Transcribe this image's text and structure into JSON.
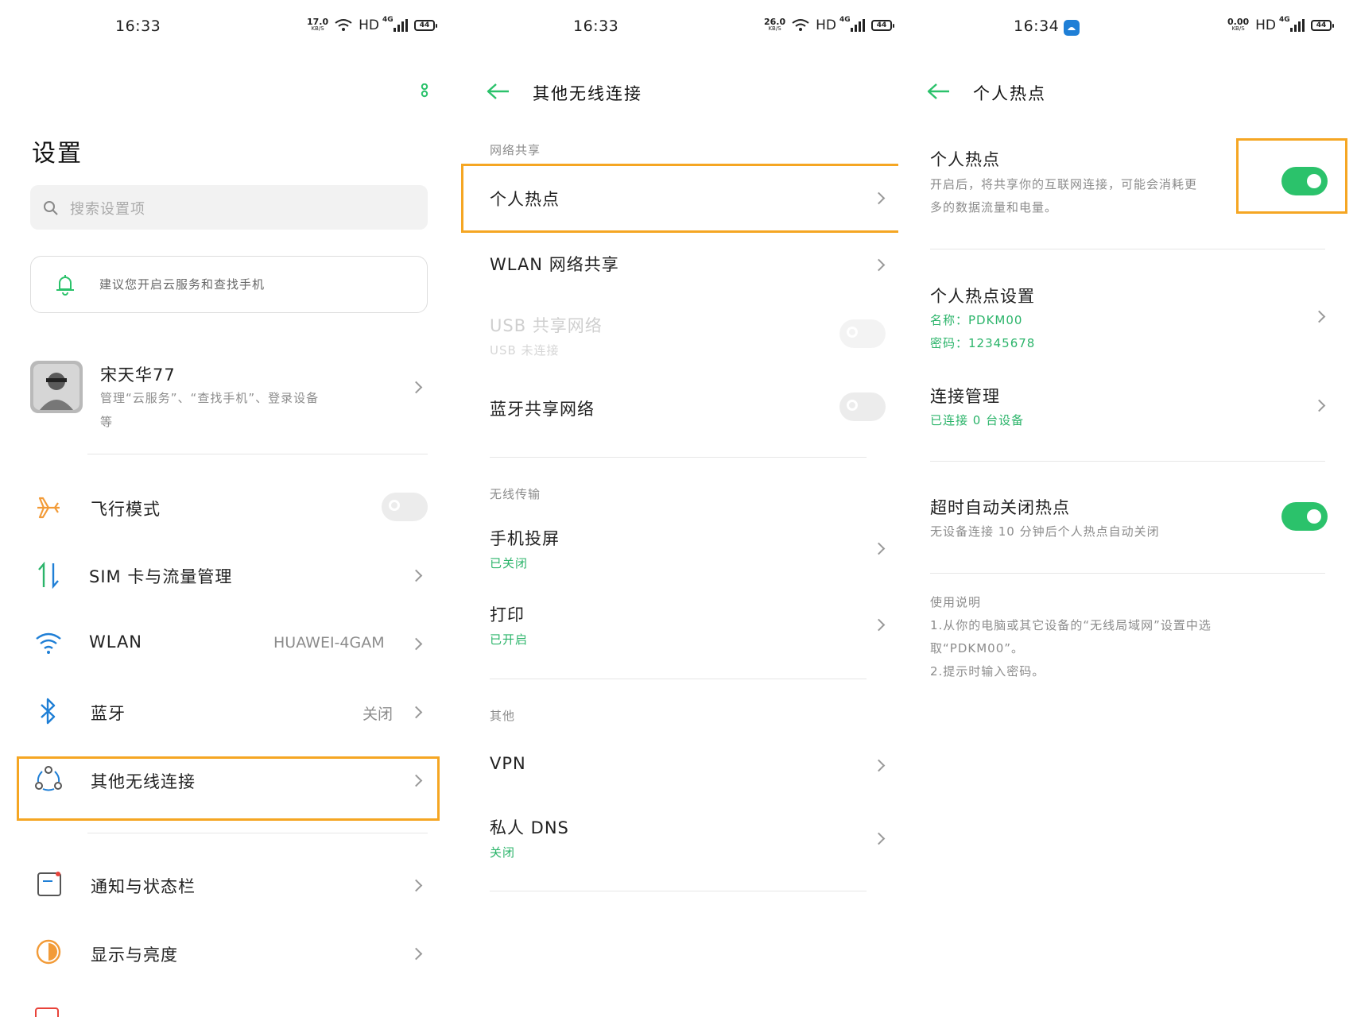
{
  "accent_color": "#2bc26b",
  "highlight_color": "#f5a623",
  "screen1": {
    "status": {
      "time": "16:33",
      "speed": "17.0",
      "speed_unit": "KB/S",
      "hd": "HD",
      "net": "4G",
      "battery": "44"
    },
    "title": "设置",
    "search": {
      "placeholder": "搜索设置项"
    },
    "notice": "建议您开启云服务和查找手机",
    "account": {
      "name": "宋天华77",
      "desc_line1": "管理“云服务”、“查找手机”、登录设备",
      "desc_line2": "等"
    },
    "items": [
      {
        "label": "飞行模式",
        "icon": "airplane-icon",
        "toggle": "off"
      },
      {
        "label": "SIM 卡与流量管理",
        "icon": "sim-data-icon"
      },
      {
        "label": "WLAN",
        "icon": "wifi-icon",
        "value": "HUAWEI-4GAM"
      },
      {
        "label": "蓝牙",
        "icon": "bluetooth-icon",
        "value": "关闭"
      },
      {
        "label": "其他无线连接",
        "icon": "connections-icon",
        "highlighted": true
      },
      {
        "label": "通知与状态栏",
        "icon": "notification-icon"
      },
      {
        "label": "显示与亮度",
        "icon": "display-icon"
      }
    ]
  },
  "screen2": {
    "status": {
      "time": "16:33",
      "speed": "26.0",
      "speed_unit": "KB/S",
      "hd": "HD",
      "net": "4G",
      "battery": "44"
    },
    "title": "其他无线连接",
    "sections": [
      {
        "label": "网络共享"
      },
      {
        "label": "无线传输"
      },
      {
        "label": "其他"
      }
    ],
    "items": [
      {
        "label": "个人热点",
        "highlighted": true
      },
      {
        "label": "WLAN 网络共享"
      },
      {
        "label": "USB 共享网络",
        "sub": "USB 未连接",
        "toggle": "off",
        "disabled": true
      },
      {
        "label": "蓝牙共享网络",
        "toggle": "off"
      },
      {
        "label": "手机投屏",
        "sub": "已关闭"
      },
      {
        "label": "打印",
        "sub": "已开启"
      },
      {
        "label": "VPN"
      },
      {
        "label": "私人 DNS",
        "sub": "关闭"
      }
    ]
  },
  "screen3": {
    "status": {
      "time": "16:34",
      "speed": "0.00",
      "speed_unit": "KB/S",
      "hd": "HD",
      "net": "4G",
      "battery": "44"
    },
    "title": "个人热点",
    "hotspot": {
      "label": "个人热点",
      "desc_line1": "开启后，将共享你的互联网连接，可能会消耗更",
      "desc_line2": "多的数据流量和电量。",
      "toggle": "on"
    },
    "settings": {
      "label": "个人热点设置",
      "name_line": "名称：PDKM00",
      "password_line": "密码：12345678"
    },
    "connections": {
      "label": "连接管理",
      "sub": "已连接 0 台设备"
    },
    "auto_off": {
      "label": "超时自动关闭热点",
      "sub": "无设备连接 10 分钟后个人热点自动关闭",
      "toggle": "on"
    },
    "usage": {
      "title": "使用说明",
      "line1": "1.从你的电脑或其它设备的“无线局域网”设置中选",
      "line2": "取“PDKM00”。",
      "line3": "2.提示时输入密码。"
    }
  }
}
